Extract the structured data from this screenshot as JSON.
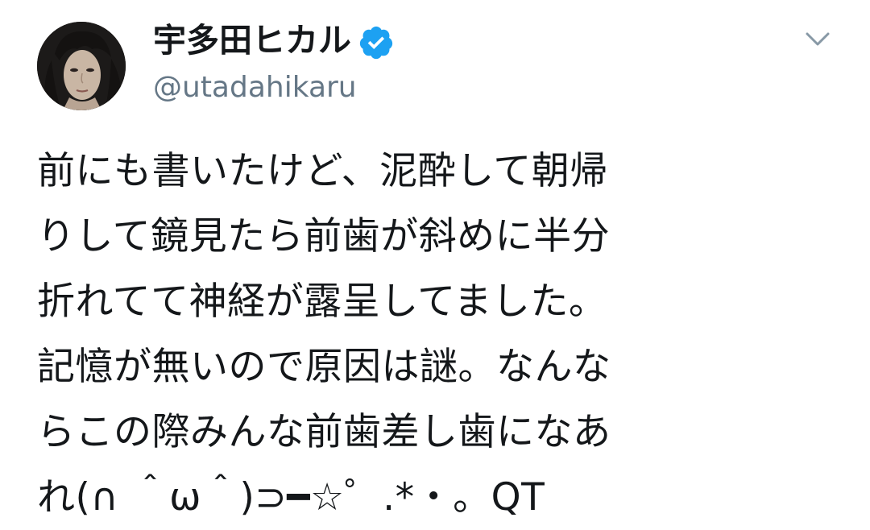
{
  "author": {
    "display_name": "宇多田ヒカル",
    "handle": "@utadahikaru",
    "verified": true,
    "verified_color": "#1da1f2"
  },
  "menu": {
    "icon": "chevron-down-icon"
  },
  "tweet": {
    "lines": [
      "前にも書いたけど、泥酔して朝帰",
      "りして鏡見たら前歯が斜めに半分",
      "折れてて神経が露呈してました。",
      "記憶が無いので原因は謎。なんな",
      "らこの際みんな前歯差し歯になあ",
      "れ(∩ ＾ω＾)⊃━☆゜.*・。QT"
    ]
  }
}
